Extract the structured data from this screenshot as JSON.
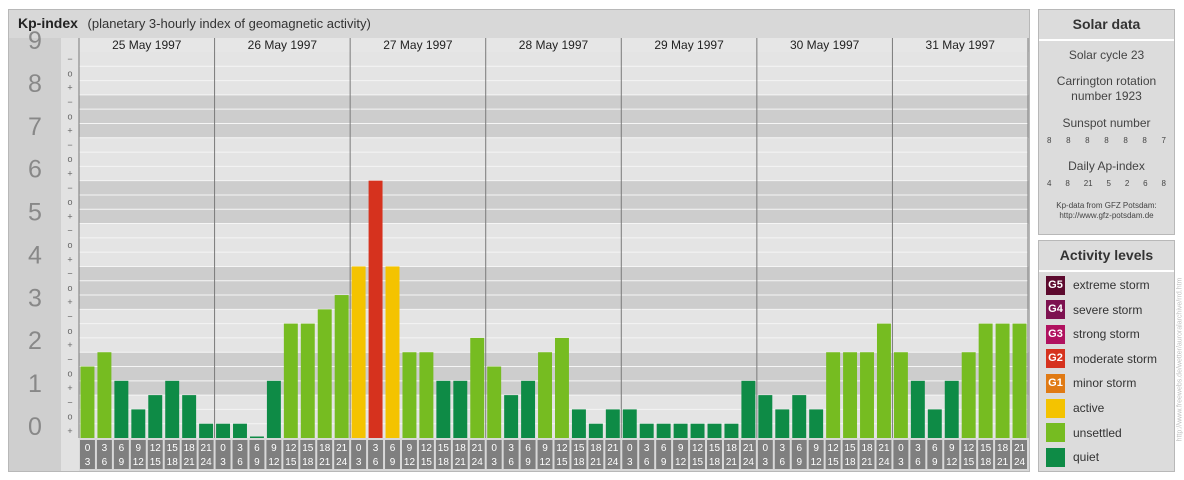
{
  "header": {
    "title": "Kp-index",
    "subtitle": "(planetary 3-hourly index of geomagnetic activity)"
  },
  "chart_data": {
    "type": "bar",
    "title": "Kp-index",
    "subtitle": "(planetary 3-hourly index of geomagnetic activity)",
    "ylim": [
      0,
      9
    ],
    "y_ticks": [
      "0",
      "1",
      "2",
      "3",
      "4",
      "5",
      "6",
      "7",
      "8",
      "9"
    ],
    "minor_tick_labels": [
      "+",
      "o",
      "−"
    ],
    "days": [
      "25 May 1997",
      "26 May 1997",
      "27 May 1997",
      "28 May 1997",
      "29 May 1997",
      "30 May 1997",
      "31 May 1997"
    ],
    "interval_start_labels": [
      "0",
      "3",
      "6",
      "9",
      "12",
      "15",
      "18",
      "21"
    ],
    "interval_end_labels": [
      "3",
      "6",
      "9",
      "12",
      "15",
      "18",
      "21",
      "24"
    ],
    "values": [
      1.667,
      2.0,
      1.333,
      0.667,
      1.0,
      1.333,
      1.0,
      0.333,
      0.333,
      0.333,
      0.0,
      1.333,
      2.667,
      2.667,
      3.0,
      3.333,
      4.0,
      6.0,
      4.0,
      2.0,
      2.0,
      1.333,
      1.333,
      2.333,
      1.667,
      1.0,
      1.333,
      2.0,
      2.333,
      0.667,
      0.333,
      0.667,
      0.667,
      0.333,
      0.333,
      0.333,
      0.333,
      0.333,
      0.333,
      1.333,
      1.0,
      0.667,
      1.0,
      0.667,
      2.0,
      2.0,
      2.0,
      2.667,
      2.0,
      1.333,
      0.667,
      1.333,
      2.0,
      2.667,
      2.667,
      2.667
    ],
    "grid": true
  },
  "solar": {
    "heading": "Solar data",
    "cycle": "Solar cycle 23",
    "carrington_1": "Carrington rotation",
    "carrington_2": "number 1923",
    "sunspot_label": "Sunspot number",
    "sunspot_values": [
      "8",
      "8",
      "8",
      "8",
      "8",
      "8",
      "7"
    ],
    "ap_label": "Daily Ap-index",
    "ap_values": [
      "4",
      "8",
      "21",
      "5",
      "2",
      "6",
      "8"
    ],
    "source_1": "Kp-data from GFZ Potsdam:",
    "source_2": "http://www.gfz-potsdam.de"
  },
  "activity": {
    "heading": "Activity levels",
    "levels": [
      {
        "code": "G5",
        "label": "extreme storm",
        "color": "#5c0a2e"
      },
      {
        "code": "G4",
        "label": "severe storm",
        "color": "#7d1150"
      },
      {
        "code": "G3",
        "label": "strong storm",
        "color": "#b0115f"
      },
      {
        "code": "G2",
        "label": "moderate storm",
        "color": "#d6321e"
      },
      {
        "code": "G1",
        "label": "minor storm",
        "color": "#e07a14"
      },
      {
        "code": "",
        "label": "active",
        "color": "#f4c300"
      },
      {
        "code": "",
        "label": "unsettled",
        "color": "#76bc21"
      },
      {
        "code": "",
        "label": "quiet",
        "color": "#0e8b46"
      }
    ]
  },
  "watermark": "http://www.freewebs.de/wetter/auroralarchive/rrd.htm"
}
